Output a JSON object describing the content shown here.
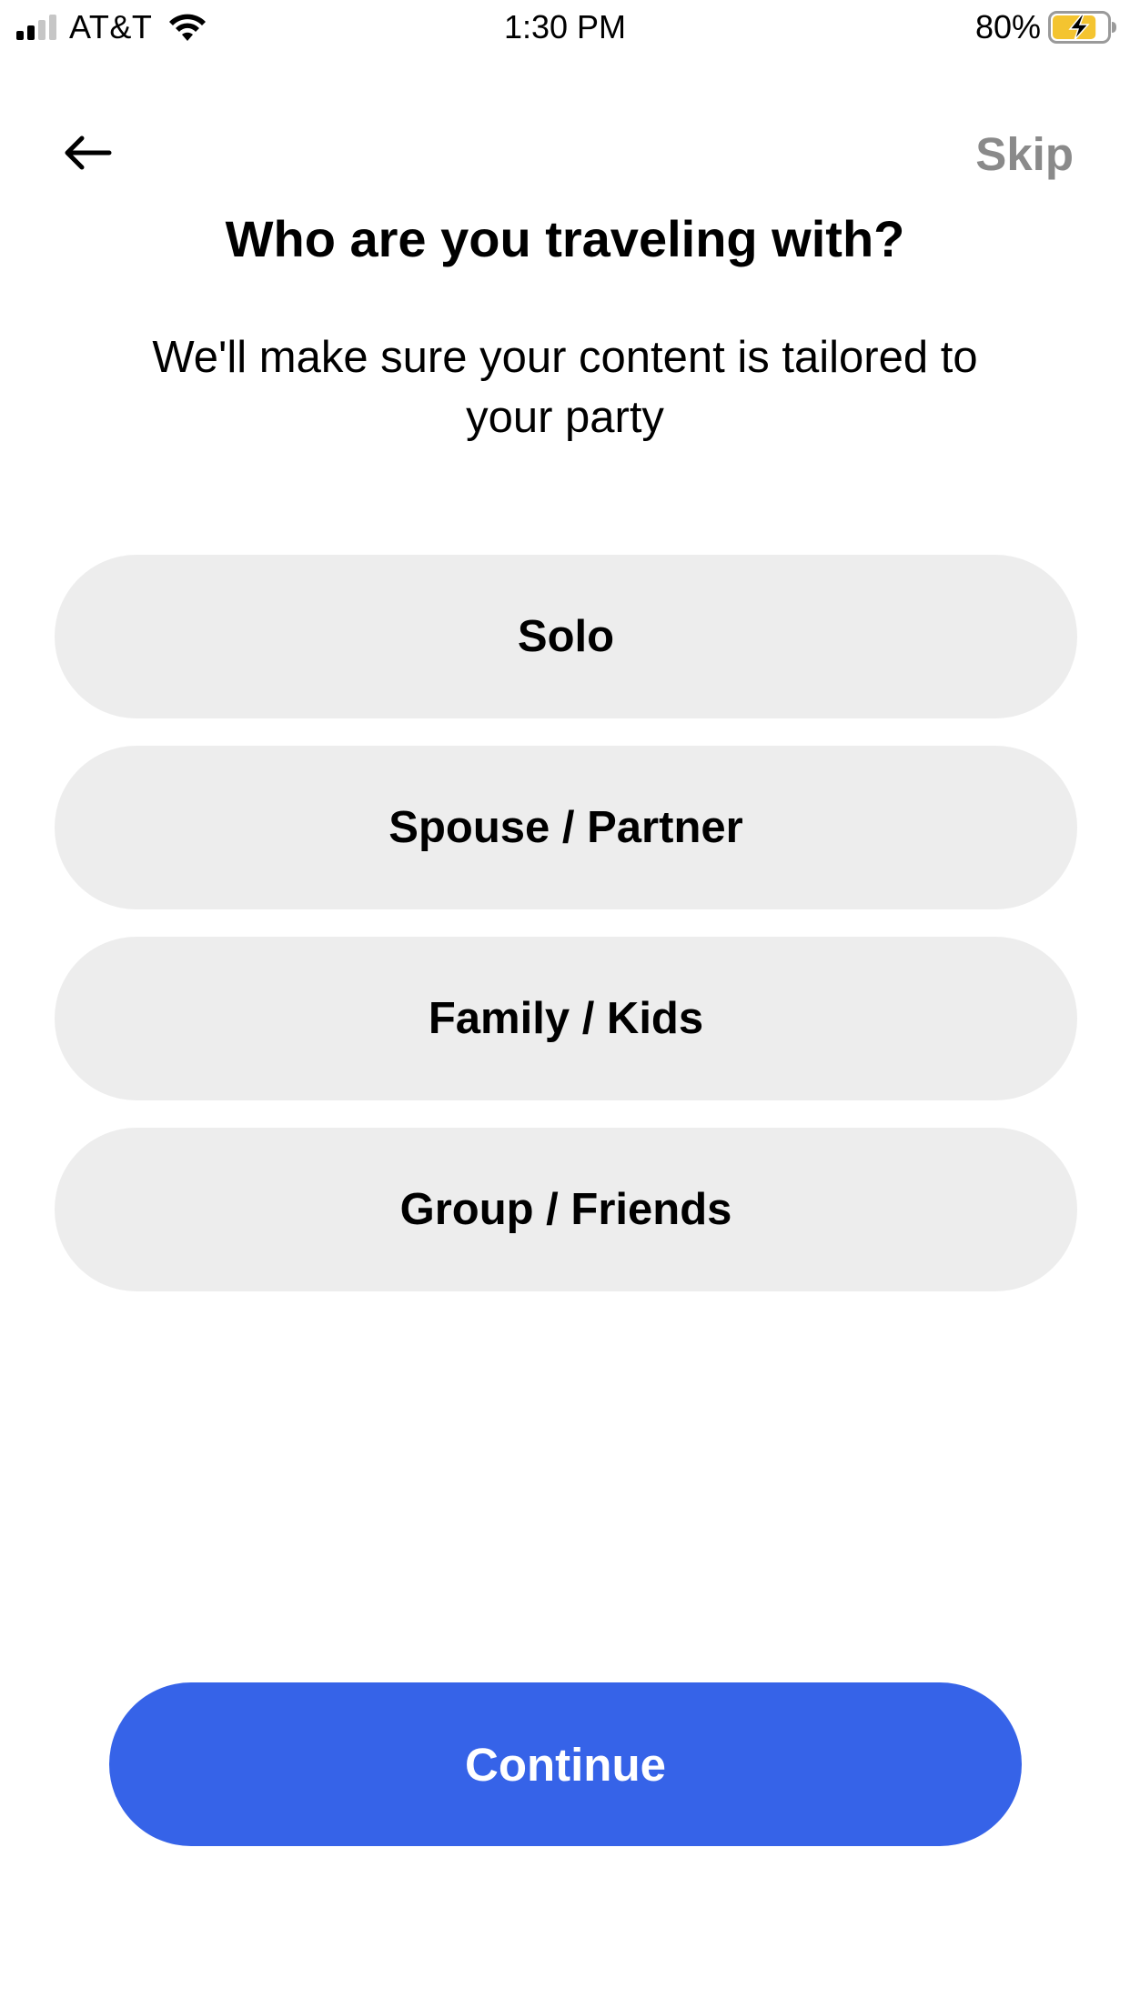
{
  "status_bar": {
    "carrier": "AT&T",
    "time": "1:30 PM",
    "battery_percent": "80%",
    "signal_bars": 2,
    "signal_bars_total": 4,
    "battery_level": 0.8,
    "charging": true
  },
  "nav": {
    "back_icon": "back-arrow-icon",
    "skip_label": "Skip"
  },
  "title": "Who are you traveling with?",
  "subtitle": "We'll make sure your content is tailored to your party",
  "options": [
    {
      "label": "Solo"
    },
    {
      "label": "Spouse / Partner"
    },
    {
      "label": "Family / Kids"
    },
    {
      "label": "Group / Friends"
    }
  ],
  "continue_label": "Continue",
  "colors": {
    "primary": "#3663e8",
    "option_bg": "#ededed",
    "skip_text": "#8a8a8a",
    "battery_fill": "#f4c430"
  }
}
